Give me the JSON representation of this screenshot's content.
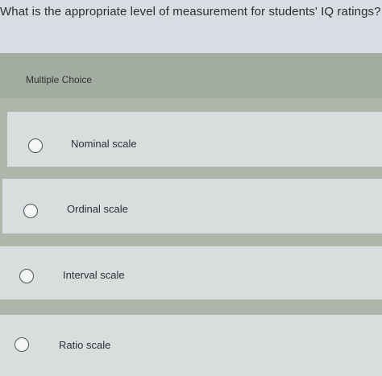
{
  "question": {
    "text": "What is the appropriate level of measurement for students' IQ ratings?"
  },
  "multiple_choice": {
    "label": "Multiple Choice",
    "options": [
      {
        "label": "Nominal scale"
      },
      {
        "label": "Ordinal scale"
      },
      {
        "label": "Interval scale"
      },
      {
        "label": "Ratio scale"
      }
    ]
  }
}
